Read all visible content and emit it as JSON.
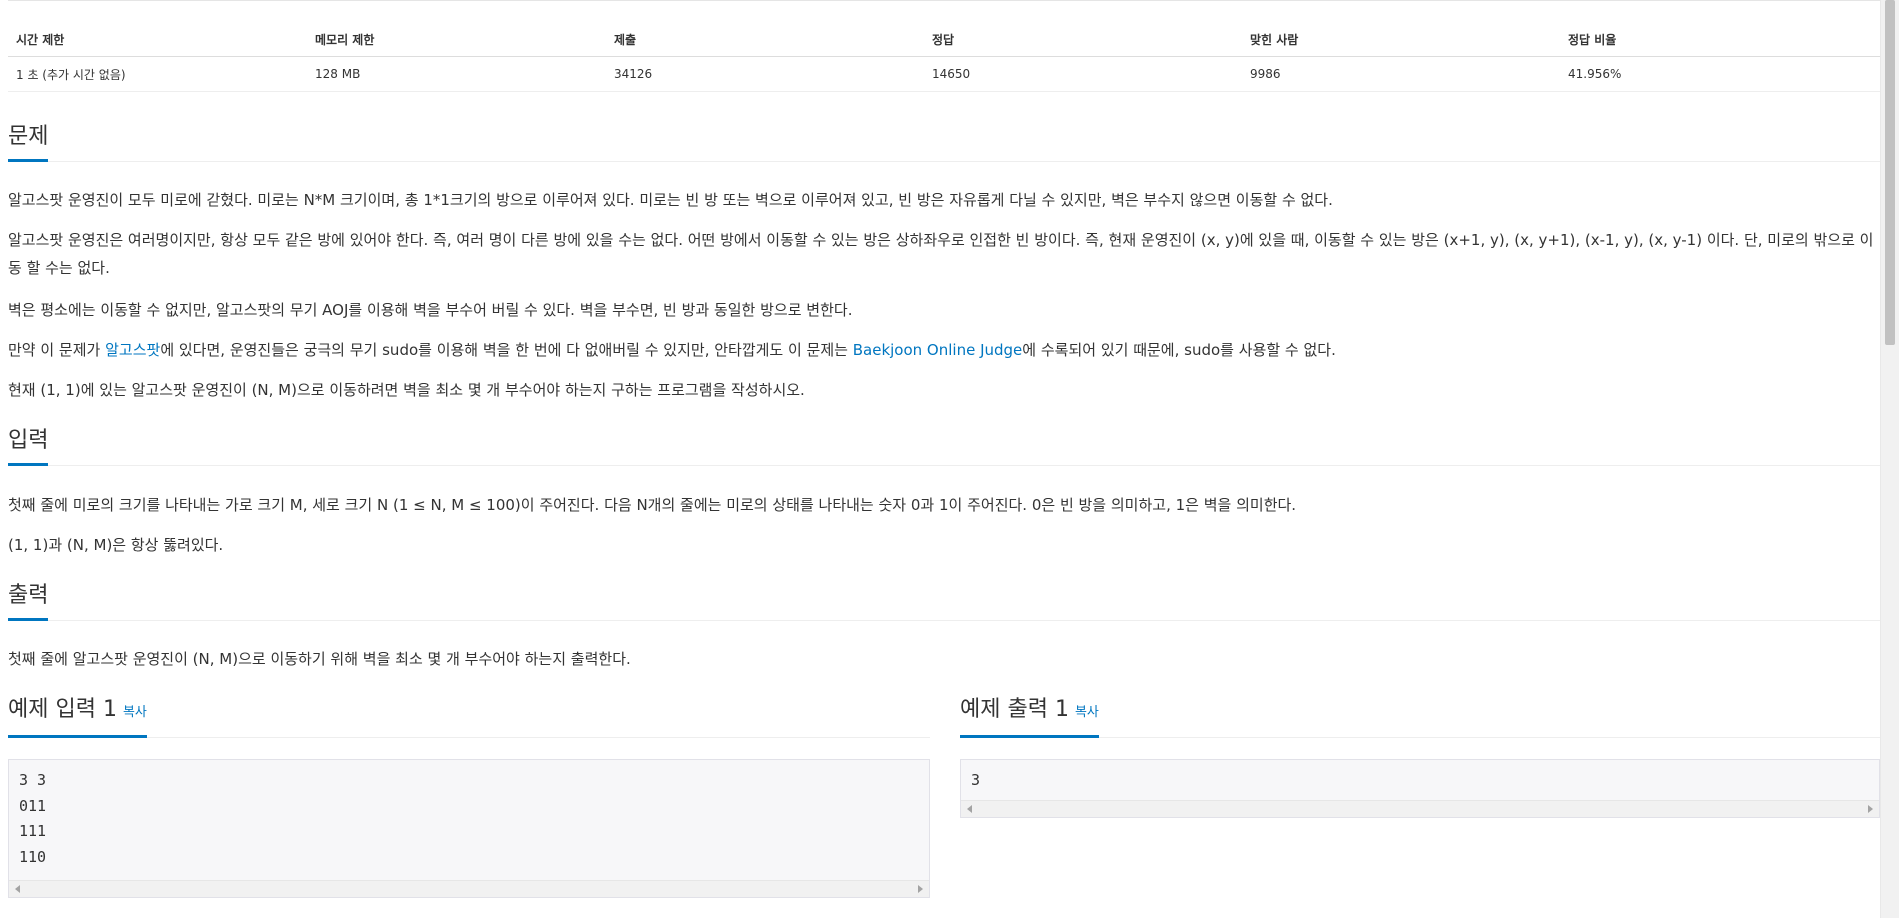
{
  "info_table": {
    "headers": [
      "시간 제한",
      "메모리 제한",
      "제출",
      "정답",
      "맞힌 사람",
      "정답 비율"
    ],
    "values": [
      "1 초 (추가 시간 없음)",
      "128 MB",
      "34126",
      "14650",
      "9986",
      "41.956%"
    ]
  },
  "problem": {
    "title": "문제",
    "p1": "알고스팟 운영진이 모두 미로에 갇혔다. 미로는 N*M 크기이며, 총 1*1크기의 방으로 이루어져 있다. 미로는 빈 방 또는 벽으로 이루어져 있고, 빈 방은 자유롭게 다닐 수 있지만, 벽은 부수지 않으면 이동할 수 없다.",
    "p2": "알고스팟 운영진은 여러명이지만, 항상 모두 같은 방에 있어야 한다. 즉, 여러 명이 다른 방에 있을 수는 없다. 어떤 방에서 이동할 수 있는 방은 상하좌우로 인접한 빈 방이다. 즉, 현재 운영진이 (x, y)에 있을 때, 이동할 수 있는 방은 (x+1, y), (x, y+1), (x-1, y), (x, y-1) 이다. 단, 미로의 밖으로 이동 할 수는 없다.",
    "p3": "벽은 평소에는 이동할 수 없지만, 알고스팟의 무기 AOJ를 이용해 벽을 부수어 버릴 수 있다. 벽을 부수면, 빈 방과 동일한 방으로 변한다.",
    "p4_pre": "만약 이 문제가 ",
    "p4_link1": "알고스팟",
    "p4_mid": "에 있다면, 운영진들은 궁극의 무기 sudo를 이용해 벽을 한 번에 다 없애버릴 수 있지만, 안타깝게도 이 문제는 ",
    "p4_link2": "Baekjoon Online Judge",
    "p4_post": "에 수록되어 있기 때문에, sudo를 사용할 수 없다.",
    "p5": "현재 (1, 1)에 있는 알고스팟 운영진이 (N, M)으로 이동하려면 벽을 최소 몇 개 부수어야 하는지 구하는 프로그램을 작성하시오."
  },
  "input": {
    "title": "입력",
    "p1": "첫째 줄에 미로의 크기를 나타내는 가로 크기 M, 세로 크기 N (1 ≤ N, M ≤ 100)이 주어진다. 다음 N개의 줄에는 미로의 상태를 나타내는 숫자 0과 1이 주어진다. 0은 빈 방을 의미하고, 1은 벽을 의미한다.",
    "p2": "(1, 1)과 (N, M)은 항상 뚫려있다."
  },
  "output": {
    "title": "출력",
    "p1": "첫째 줄에 알고스팟 운영진이 (N, M)으로 이동하기 위해 벽을 최소 몇 개 부수어야 하는지 출력한다."
  },
  "sample_input": {
    "title": "예제 입력 1",
    "copy": "복사",
    "text": "3 3\n011\n111\n110"
  },
  "sample_output": {
    "title": "예제 출력 1",
    "copy": "복사",
    "text": "3"
  }
}
